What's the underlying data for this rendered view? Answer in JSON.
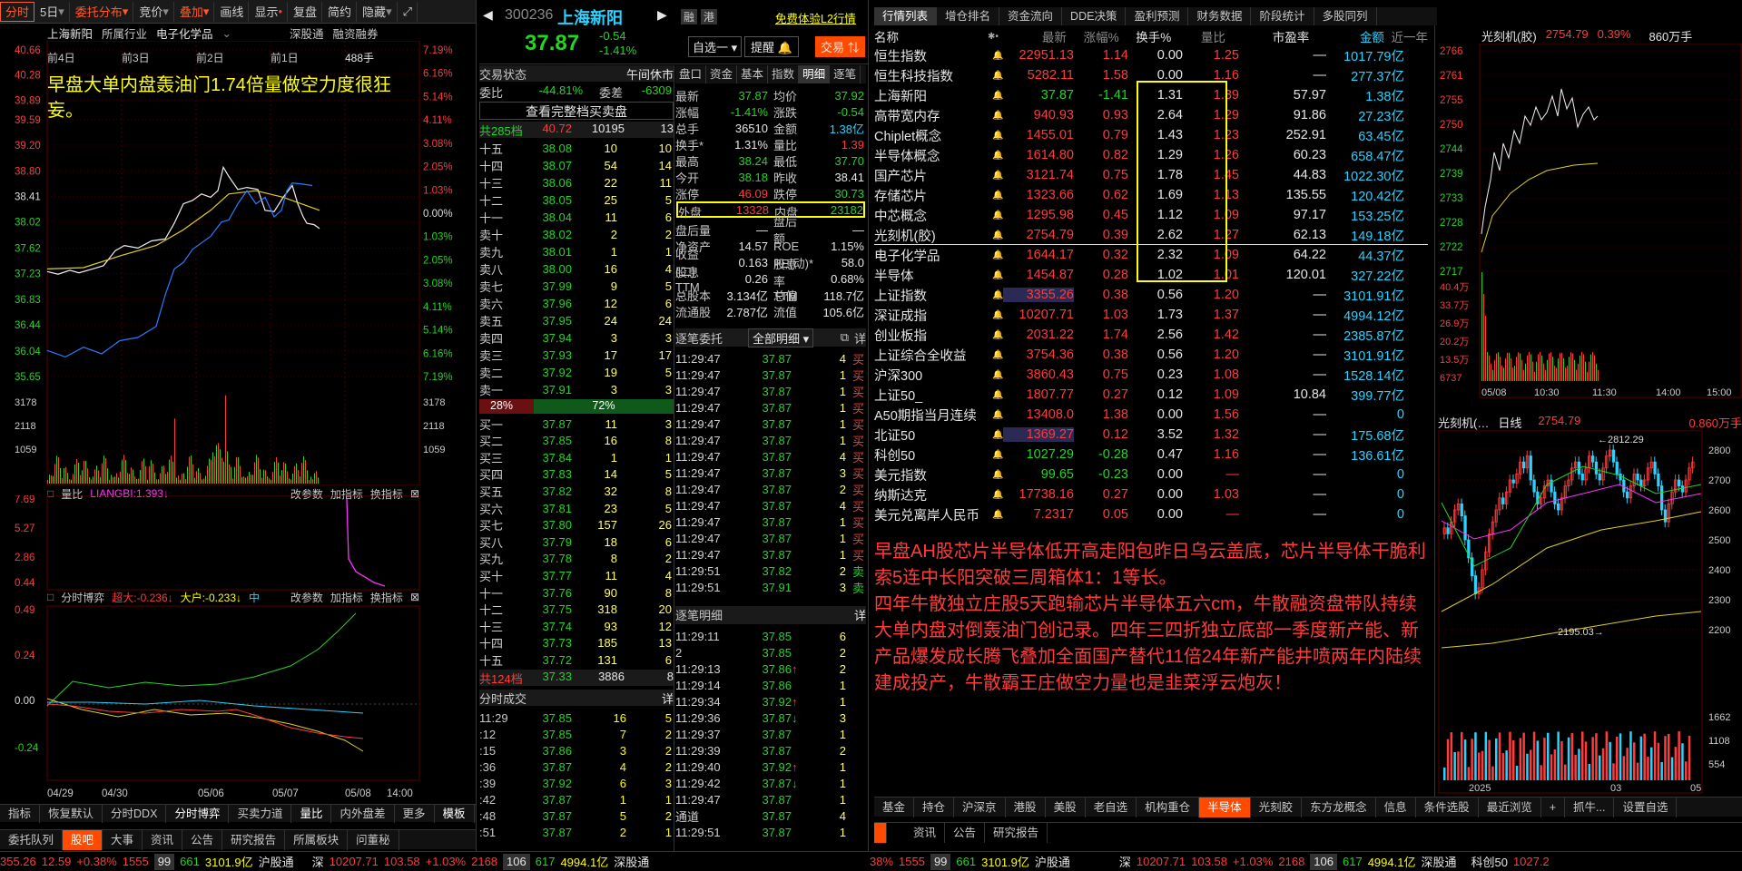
{
  "toolbar": {
    "items": [
      "分时",
      "5日",
      "委托分布",
      "竞价",
      "叠加",
      "画线",
      "显示",
      "复盘",
      "简约",
      "隐藏"
    ]
  },
  "stock": {
    "code": "300236",
    "name": "上海新阳",
    "price": "37.87",
    "change": "-0.54",
    "pct": "-1.41%",
    "promo": "免费体验L2行情",
    "zixuan": "自选一",
    "tixing": "提醒",
    "jiaoyi": "交易"
  },
  "chart_left": {
    "header": [
      "上海新阳",
      "所属行业",
      "电子化学品",
      "深股通",
      "融资融券"
    ],
    "days": [
      "前4日",
      "前3日",
      "前2日",
      "前1日"
    ],
    "vol_label": "488手",
    "price_ticks": [
      "40.66",
      "40.28",
      "39.89",
      "39.59",
      "39.20",
      "38.80",
      "38.41",
      "38.02",
      "37.62",
      "37.23",
      "36.83",
      "36.44",
      "36.04",
      "35.65"
    ],
    "pct_ticks": [
      "7.19%",
      "6.16%",
      "5.14%",
      "4.11%",
      "3.08%",
      "2.05%",
      "1.03%",
      "0.00%",
      "1.03%",
      "2.05%",
      "3.08%",
      "4.11%",
      "5.14%",
      "6.16%",
      "7.19%"
    ],
    "annotation": "早盘大单内盘轰油门1.74倍量做空力度很狂妄。",
    "vol_ticks": [
      "3178",
      "2118",
      "1059"
    ],
    "lb_header": [
      "量比",
      "LIANGBI:1.393↓",
      "改参数",
      "加指标",
      "换指标"
    ],
    "lb_ticks": [
      "7.69",
      "5.27",
      "2.86",
      "0.44"
    ],
    "bo_header": [
      "分时博弈",
      "超大:-0.236↓",
      "大户:-0.233↓",
      "中",
      "改参数",
      "加指标",
      "换指标"
    ],
    "bo_ticks": [
      "0.49",
      "0.24",
      "0.00",
      "-0.24"
    ],
    "dates": [
      "04/29",
      "04/30",
      "05/06",
      "05/07",
      "05/08",
      "14:00"
    ],
    "subtabs": [
      "指标",
      "恢复默认",
      "分时DDX",
      "分时博弈",
      "买卖力道",
      "量比",
      "内外盘差",
      "更多",
      "模板"
    ],
    "bottomtabs": [
      "委托队列",
      "股吧",
      "大事",
      "资讯",
      "公告",
      "研究报告",
      "所属板块",
      "问董秘"
    ]
  },
  "depth": {
    "header": [
      "交易状态",
      "午间休市"
    ],
    "weibi": [
      "委比",
      "-44.81%",
      "委差",
      "-6309"
    ],
    "full": "查看完整档买卖盘",
    "sell_total": [
      "共285档",
      "40.72",
      "10195",
      "13"
    ],
    "sells": [
      [
        "十五",
        "38.08",
        "10",
        "10"
      ],
      [
        "十四",
        "38.07",
        "54",
        "14"
      ],
      [
        "十三",
        "38.06",
        "22",
        "11"
      ],
      [
        "十二",
        "38.05",
        "25",
        "5"
      ],
      [
        "十一",
        "38.04",
        "11",
        "6"
      ],
      [
        "卖十",
        "38.02",
        "2",
        "2"
      ],
      [
        "卖九",
        "38.01",
        "1",
        "1"
      ],
      [
        "卖八",
        "38.00",
        "16",
        "4"
      ],
      [
        "卖七",
        "37.99",
        "9",
        "5"
      ],
      [
        "卖六",
        "37.96",
        "12",
        "6"
      ],
      [
        "卖五",
        "37.95",
        "24",
        "24"
      ],
      [
        "卖四",
        "37.94",
        "3",
        "3"
      ],
      [
        "卖三",
        "37.93",
        "17",
        "17"
      ],
      [
        "卖二",
        "37.92",
        "19",
        "5"
      ],
      [
        "卖一",
        "37.91",
        "3",
        "3"
      ]
    ],
    "bar": [
      "28%",
      "72%"
    ],
    "buys": [
      [
        "买一",
        "37.87",
        "11",
        "3"
      ],
      [
        "买二",
        "37.85",
        "16",
        "8"
      ],
      [
        "买三",
        "37.84",
        "1",
        "1"
      ],
      [
        "买四",
        "37.83",
        "14",
        "5"
      ],
      [
        "买五",
        "37.82",
        "32",
        "8"
      ],
      [
        "买六",
        "37.81",
        "23",
        "5"
      ],
      [
        "买七",
        "37.80",
        "157",
        "26"
      ],
      [
        "买八",
        "37.79",
        "18",
        "6"
      ],
      [
        "买九",
        "37.78",
        "8",
        "2"
      ],
      [
        "买十",
        "37.77",
        "11",
        "4"
      ],
      [
        "十一",
        "37.76",
        "90",
        "8"
      ],
      [
        "十二",
        "37.75",
        "318",
        "20"
      ],
      [
        "十三",
        "37.74",
        "93",
        "12"
      ],
      [
        "十四",
        "37.73",
        "185",
        "13"
      ],
      [
        "十五",
        "37.72",
        "131",
        "6"
      ]
    ],
    "buy_total": [
      "共124档",
      "37.33",
      "3886",
      "8"
    ]
  },
  "fenshi": {
    "title": "分时成交",
    "more": "详",
    "rows": [
      [
        "11:29",
        "37.85",
        "16",
        "5"
      ],
      [
        ":12",
        "37.85",
        "7",
        "2"
      ],
      [
        ":15",
        "37.86",
        "3",
        "2"
      ],
      [
        ":36",
        "37.87",
        "4",
        "2"
      ],
      [
        ":39",
        "37.92",
        "6",
        "3"
      ],
      [
        ":42",
        "37.87",
        "1",
        "1"
      ],
      [
        ":48",
        "37.87",
        "5",
        "2"
      ],
      [
        ":51",
        "37.87",
        "2",
        "1"
      ]
    ]
  },
  "quote": {
    "tabs": [
      "盘口",
      "资金",
      "基本",
      "指数",
      "明细",
      "逐笔"
    ],
    "rows": [
      [
        "最新",
        "37.87",
        "均价",
        "37.92"
      ],
      [
        "涨幅",
        "-1.41%",
        "涨跌",
        "-0.54"
      ],
      [
        "总手",
        "36510",
        "金额",
        "1.38亿"
      ],
      [
        "换手*",
        "1.31%",
        "量比",
        "1.39"
      ],
      [
        "最高",
        "38.24",
        "最低",
        "37.70"
      ],
      [
        "今开",
        "38.18",
        "昨收",
        "38.41"
      ],
      [
        "涨停",
        "46.09",
        "跌停",
        "30.73"
      ]
    ],
    "waipan": [
      "外盘",
      "13328",
      "内盘",
      "23182"
    ],
    "rows2": [
      [
        "盘后量",
        "—",
        "盘后额",
        "—"
      ],
      [
        "净资产",
        "14.57",
        "ROE",
        "1.15%"
      ],
      [
        "收益(二)",
        "0.163",
        "PE(动)*",
        "58.0"
      ],
      [
        "股息TTM",
        "0.26",
        "股息率TTM",
        "0.68%"
      ],
      [
        "总股本",
        "3.134亿",
        "总值",
        "118.7亿"
      ],
      [
        "流通股",
        "2.787亿",
        "流值",
        "105.6亿"
      ]
    ],
    "zhubi_title": "逐笔委托",
    "zhubi_sel": "全部明细",
    "zhubi": [
      [
        "11:29:47",
        "37.87",
        "4",
        "买"
      ],
      [
        "11:29:47",
        "37.87",
        "1",
        "买"
      ],
      [
        "11:29:47",
        "37.87",
        "1",
        "买"
      ],
      [
        "11:29:47",
        "37.87",
        "1",
        "买"
      ],
      [
        "11:29:47",
        "37.87",
        "1",
        "买"
      ],
      [
        "11:29:47",
        "37.87",
        "1",
        "买"
      ],
      [
        "11:29:47",
        "37.87",
        "4",
        "买"
      ],
      [
        "11:29:47",
        "37.87",
        "3",
        "买"
      ],
      [
        "11:29:47",
        "37.87",
        "2",
        "买"
      ],
      [
        "11:29:47",
        "37.87",
        "4",
        "买"
      ],
      [
        "11:29:47",
        "37.87",
        "1",
        "买"
      ],
      [
        "11:29:47",
        "37.87",
        "1",
        "买"
      ],
      [
        "11:29:47",
        "37.87",
        "1",
        "买"
      ],
      [
        "11:29:51",
        "37.82",
        "2",
        "卖"
      ],
      [
        "11:29:51",
        "37.91",
        "3",
        "卖"
      ]
    ],
    "mingxi_title": "逐笔明细",
    "mingxi_more": "详",
    "mingxi": [
      [
        "11:29:11",
        "37.85",
        "6",
        ""
      ],
      [
        "2",
        "37.85",
        "2",
        ""
      ],
      [
        "11:29:13",
        "37.86",
        "2",
        "↑"
      ],
      [
        "11:29:14",
        "37.86",
        "1",
        ""
      ],
      [
        "11:29:34",
        "37.92",
        "1",
        "↑"
      ],
      [
        "11:29:36",
        "37.87",
        "3",
        "↓"
      ],
      [
        "11:29:37",
        "37.87",
        "1",
        ""
      ],
      [
        "11:29:39",
        "37.87",
        "2",
        ""
      ],
      [
        "11:29:40",
        "37.92",
        "1",
        "↑"
      ],
      [
        "11:29:42",
        "37.87",
        "1",
        "↓"
      ],
      [
        "11:29:47",
        "37.87",
        "1",
        ""
      ],
      [
        "通道",
        "37.87",
        "4",
        ""
      ],
      [
        "11:29:51",
        "37.87",
        "1",
        ""
      ]
    ]
  },
  "market": {
    "tabs": [
      "行情列表",
      "增仓排名",
      "资金流向",
      "DDE决策",
      "盈利预测",
      "财务数据",
      "阶段统计",
      "多股同列"
    ],
    "headers": [
      "名称",
      "最新",
      "涨幅%",
      "换手%",
      "量比",
      "市盈率",
      "金额",
      "近一年"
    ],
    "rows": [
      [
        "恒生指数",
        "22951.13",
        "1.14",
        "0.00",
        "1.25",
        "—",
        "1017.79亿"
      ],
      [
        "恒生科技指数",
        "5282.11",
        "1.58",
        "0.00",
        "1.16",
        "—",
        "277.37亿"
      ],
      [
        "上海新阳",
        "37.87",
        "-1.41",
        "1.31",
        "1.39",
        "57.97",
        "1.38亿"
      ],
      [
        "高带宽内存",
        "940.93",
        "0.93",
        "2.64",
        "1.29",
        "91.86",
        "27.23亿"
      ],
      [
        "Chiplet概念",
        "1455.01",
        "0.79",
        "1.43",
        "1.23",
        "252.91",
        "63.45亿"
      ],
      [
        "半导体概念",
        "1614.80",
        "0.82",
        "1.29",
        "1.26",
        "60.23",
        "658.47亿"
      ],
      [
        "国产芯片",
        "3121.74",
        "0.75",
        "1.78",
        "1.45",
        "44.83",
        "1022.30亿"
      ],
      [
        "存储芯片",
        "1323.66",
        "0.62",
        "1.69",
        "1.13",
        "135.55",
        "120.42亿"
      ],
      [
        "中芯概念",
        "1295.98",
        "0.45",
        "1.12",
        "1.09",
        "97.17",
        "153.25亿"
      ],
      [
        "光刻机(胶)",
        "2754.79",
        "0.39",
        "2.62",
        "1.27",
        "62.13",
        "149.18亿"
      ],
      [
        "电子化学品",
        "1644.17",
        "0.32",
        "2.32",
        "1.09",
        "64.22",
        "44.37亿"
      ],
      [
        "半导体",
        "1454.87",
        "0.28",
        "1.02",
        "1.01",
        "120.01",
        "327.22亿"
      ],
      [
        "上证指数",
        "3355.26",
        "0.38",
        "0.56",
        "1.20",
        "—",
        "3101.91亿"
      ],
      [
        "深证成指",
        "10207.71",
        "1.03",
        "1.73",
        "1.37",
        "—",
        "4994.12亿"
      ],
      [
        "创业板指",
        "2031.22",
        "1.74",
        "2.56",
        "1.42",
        "—",
        "2385.87亿"
      ],
      [
        "上证综合全收益",
        "3754.36",
        "0.38",
        "0.56",
        "1.20",
        "—",
        "3101.91亿"
      ],
      [
        "沪深300",
        "3860.43",
        "0.75",
        "0.23",
        "1.08",
        "—",
        "1528.14亿"
      ],
      [
        "上证50_",
        "1807.77",
        "0.27",
        "0.12",
        "1.09",
        "10.84",
        "399.77亿"
      ],
      [
        "A50期指当月连续",
        "13408.0",
        "1.38",
        "0.00",
        "1.56",
        "—",
        "0"
      ],
      [
        "北证50",
        "1369.27",
        "0.12",
        "3.52",
        "1.32",
        "—",
        "175.68亿"
      ],
      [
        "科创50",
        "1027.29",
        "-0.28",
        "0.47",
        "1.16",
        "—",
        "136.61亿"
      ],
      [
        "美元指数",
        "99.65",
        "-0.23",
        "0.00",
        "—",
        "—",
        "0"
      ],
      [
        "纳斯达克",
        "17738.16",
        "0.27",
        "0.00",
        "1.03",
        "—",
        "0"
      ],
      [
        "美元兑离岸人民币",
        "7.2317",
        "0.05",
        "0.00",
        "—",
        "—",
        "0"
      ]
    ],
    "annotation": "早盘AH股芯片半导体低开高走阳包昨日乌云盖底，芯片半导体干脆利索5连中长阳突破三周箱体1：1等长。\n四年牛散独立庄股5天跑输芯片半导体五六cm，牛散融资盘带队持续大单内盘对倒轰油门创记录。四年三四折独立底部一季度新产能、新产品爆发成长腾飞叠加全面国产替代11倍24年新产能井喷两年内陆续建成投产，牛散霸王庄做空力量也是韭菜浮云炮灰！",
    "bottomtabs": [
      "基金",
      "持仓",
      "沪深京",
      "港股",
      "美股",
      "老自选",
      "机构重仓",
      "半导体",
      "光刻胶",
      "东方龙概念",
      "信息",
      "条件选股",
      "最近浏览",
      "+",
      "抓牛...",
      "设置自选"
    ],
    "bottomtabs2": [
      "资讯",
      "公告",
      "研究报告"
    ]
  },
  "right_top": {
    "name": "光刻机(胶)",
    "price": "2754.79",
    "pct": "0.39%",
    "amt": "860万手",
    "ticks": [
      "2766",
      "2761",
      "2755",
      "2750",
      "2744",
      "2739",
      "2733",
      "2728",
      "2722",
      "2717"
    ],
    "vticks": [
      "40.4万",
      "33.7万",
      "26.9万",
      "20.2万",
      "13.5万",
      "6737"
    ],
    "times": [
      "05/08",
      "10:30",
      "11:30",
      "14:00",
      "15:00"
    ]
  },
  "right_bot": {
    "name": "光刻机(…",
    "period": "日线",
    "price": "2754.79",
    "amt": "0.860万手",
    "high": "2812.29",
    "low": "2195.03",
    "ticks": [
      "2800",
      "2700",
      "2600",
      "2500",
      "2400",
      "2300",
      "2200"
    ],
    "vticks": [
      "1662",
      "1108",
      "554"
    ],
    "year": "2025",
    "x1": "03",
    "x2": "05"
  },
  "ticker": {
    "a": [
      "355.26",
      "12.59",
      "+0.38%",
      "1555",
      "99",
      "661",
      "3101.9亿",
      "沪股通"
    ],
    "b": [
      "深",
      "10207.71",
      "103.58",
      "+1.03%",
      "2168",
      "106",
      "617",
      "4994.1亿",
      "深股通"
    ],
    "c": [
      "38%",
      "1555",
      "99",
      "661",
      "3101.9亿",
      "沪股通"
    ],
    "d": [
      "深",
      "10207.71",
      "103.58",
      "+1.03%",
      "2168",
      "106",
      "617",
      "4994.1亿",
      "深股通",
      "科创50",
      "1027.2"
    ]
  }
}
